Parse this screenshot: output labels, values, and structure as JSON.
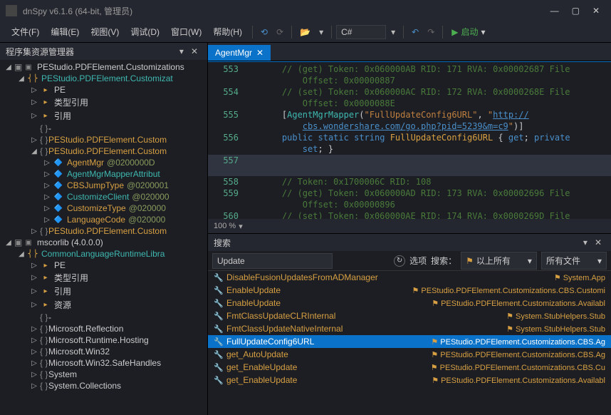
{
  "window": {
    "title": "dnSpy v6.1.6 (64-bit, 管理员)"
  },
  "menubar": {
    "items": [
      "文件(F)",
      "编辑(E)",
      "视图(V)",
      "调试(D)",
      "窗口(W)",
      "帮助(H)"
    ],
    "lang_value": "C#",
    "start_label": "启动"
  },
  "sidebar": {
    "title": "程序集资源管理器",
    "tree": [
      {
        "d": 0,
        "bul": "▣",
        "exp": "◢",
        "ticon": "asm",
        "label": "PEStudio.PDFElement.Customizations",
        "cls": "grey"
      },
      {
        "d": 1,
        "bul": "",
        "exp": "◢",
        "ticon": "ns",
        "label": "PEStudio.PDFElement.Customizat",
        "cls": "teal"
      },
      {
        "d": 2,
        "bul": "",
        "exp": "▷",
        "ticon": "folder",
        "label": "PE",
        "cls": "grey"
      },
      {
        "d": 2,
        "bul": "",
        "exp": "▷",
        "ticon": "folder",
        "label": "类型引用",
        "cls": "grey"
      },
      {
        "d": 2,
        "bul": "",
        "exp": "▷",
        "ticon": "folder",
        "label": "引用",
        "cls": "grey"
      },
      {
        "d": 2,
        "bul": "{ }",
        "exp": "",
        "ticon": "",
        "label": "-",
        "cls": "grey"
      },
      {
        "d": 2,
        "bul": "{ }",
        "exp": "▷",
        "ticon": "",
        "label": "PEStudio.PDFElement.Custom",
        "cls": "orange"
      },
      {
        "d": 2,
        "bul": "{ }",
        "exp": "◢",
        "ticon": "",
        "label": "PEStudio.PDFElement.Custom",
        "cls": "orange"
      },
      {
        "d": 3,
        "bul": "",
        "exp": "▷",
        "ticon": "cls",
        "label": "AgentMgr",
        "cls": "orange",
        "addr": "@0200000D"
      },
      {
        "d": 3,
        "bul": "",
        "exp": "▷",
        "ticon": "cls",
        "label": "AgentMgrMapperAttribut",
        "cls": "teal"
      },
      {
        "d": 3,
        "bul": "",
        "exp": "▷",
        "ticon": "cls",
        "label": "CBSJumpType",
        "cls": "orange",
        "addr": "@0200001"
      },
      {
        "d": 3,
        "bul": "",
        "exp": "▷",
        "ticon": "cls",
        "label": "CustomizeClient",
        "cls": "teal",
        "addr": "@020000"
      },
      {
        "d": 3,
        "bul": "",
        "exp": "▷",
        "ticon": "cls",
        "label": "CustomizeType",
        "cls": "orange",
        "addr": "@020000"
      },
      {
        "d": 3,
        "bul": "",
        "exp": "▷",
        "ticon": "cls",
        "label": "LanguageCode",
        "cls": "orange",
        "addr": "@020000"
      },
      {
        "d": 2,
        "bul": "{ }",
        "exp": "▷",
        "ticon": "",
        "label": "PEStudio.PDFElement.Custom",
        "cls": "orange"
      },
      {
        "d": 0,
        "bul": "▣",
        "exp": "◢",
        "ticon": "asm",
        "label": "mscorlib (4.0.0.0)",
        "cls": "grey"
      },
      {
        "d": 1,
        "bul": "",
        "exp": "◢",
        "ticon": "ns",
        "label": "CommonLanguageRuntimeLibra",
        "cls": "teal"
      },
      {
        "d": 2,
        "bul": "",
        "exp": "▷",
        "ticon": "folder",
        "label": "PE",
        "cls": "grey"
      },
      {
        "d": 2,
        "bul": "",
        "exp": "▷",
        "ticon": "folder",
        "label": "类型引用",
        "cls": "grey"
      },
      {
        "d": 2,
        "bul": "",
        "exp": "▷",
        "ticon": "folder",
        "label": "引用",
        "cls": "grey"
      },
      {
        "d": 2,
        "bul": "",
        "exp": "▷",
        "ticon": "folder",
        "label": "资源",
        "cls": "grey"
      },
      {
        "d": 2,
        "bul": "{ }",
        "exp": "",
        "ticon": "",
        "label": "-",
        "cls": "grey"
      },
      {
        "d": 2,
        "bul": "{ }",
        "exp": "▷",
        "ticon": "",
        "label": "Microsoft.Reflection",
        "cls": "grey"
      },
      {
        "d": 2,
        "bul": "{ }",
        "exp": "▷",
        "ticon": "",
        "label": "Microsoft.Runtime.Hosting",
        "cls": "grey"
      },
      {
        "d": 2,
        "bul": "{ }",
        "exp": "▷",
        "ticon": "",
        "label": "Microsoft.Win32",
        "cls": "grey"
      },
      {
        "d": 2,
        "bul": "{ }",
        "exp": "▷",
        "ticon": "",
        "label": "Microsoft.Win32.SafeHandles",
        "cls": "grey"
      },
      {
        "d": 2,
        "bul": "{ }",
        "exp": "▷",
        "ticon": "",
        "label": "System",
        "cls": "grey"
      },
      {
        "d": 2,
        "bul": "{ }",
        "exp": "▷",
        "ticon": "",
        "label": "System.Collections",
        "cls": "grey"
      }
    ]
  },
  "tabs": [
    {
      "label": "AgentMgr",
      "active": true
    }
  ],
  "editor": {
    "zoom": "100 %",
    "lines": [
      {
        "n": "553",
        "html": "<span class='cm'>// (get) Token: 0x060000AB RID: 171 RVA: 0x00002687 File</span>"
      },
      {
        "n": "",
        "html": "<span class='cm'>Offset: 0x00000887</span>"
      },
      {
        "n": "554",
        "html": "<span class='cm'>// (set) Token: 0x060000AC RID: 172 RVA: 0x0000268E File</span>"
      },
      {
        "n": "",
        "html": "<span class='cm'>Offset: 0x0000088E</span>"
      },
      {
        "n": "555",
        "html": "[<span class='ty'>AgentMgrMapper</span>(<span class='str'>\"FullUpdateConfig6URL\"</span>, <span class='str'>\"</span><span class='lnk'>http://</span>"
      },
      {
        "n": "",
        "html": "<span class='lnk'>cbs.wondershare.com/go.php?pid=5239&amp;m=c9</span><span class='str'>\"</span>)]"
      },
      {
        "n": "556",
        "html": "<span class='kw'>public</span> <span class='kw'>static</span> <span class='kw'>string</span> <span class='mth'>FullUpdateConfig6URL</span> { <span class='kw'>get</span>; <span class='kw'>private</span>"
      },
      {
        "n": "",
        "html": "<span class='kw'>set</span>; }"
      },
      {
        "n": "557",
        "html": "",
        "hl": true
      },
      {
        "n": "558",
        "html": "<span class='cm'>// Token: 0x1700006C RID: 108</span>"
      },
      {
        "n": "559",
        "html": "<span class='cm'>// (get) Token: 0x060000AD RID: 173 RVA: 0x00002696 File</span>"
      },
      {
        "n": "",
        "html": "<span class='cm'>Offset: 0x00000896</span>"
      },
      {
        "n": "560",
        "html": "<span class='cm'>// (set) Token: 0x060000AE RID: 174 RVA: 0x0000269D File</span>"
      }
    ]
  },
  "search": {
    "title": "搜索",
    "query": "Update",
    "opt_label": "选项",
    "filter_label": "搜索：",
    "filter1": "以上所有",
    "filter2": "所有文件",
    "results": [
      {
        "icon": "wrench",
        "name": "DisableFusionUpdatesFromADManager",
        "loc": "System.App",
        "sel": false
      },
      {
        "icon": "wrench",
        "name": "EnableUpdate",
        "loc": "PEStudio.PDFElement.Customizations.CBS.Customi",
        "sel": false
      },
      {
        "icon": "wrench",
        "name": "EnableUpdate",
        "loc": "PEStudio.PDFElement.Customizations.Availabl",
        "sel": false
      },
      {
        "icon": "wrench",
        "name": "FmtClassUpdateCLRInternal",
        "loc": "System.StubHelpers.Stub",
        "sel": false
      },
      {
        "icon": "wrench",
        "name": "FmtClassUpdateNativeInternal",
        "loc": "System.StubHelpers.Stub",
        "sel": false
      },
      {
        "icon": "wrench",
        "name": "FullUpdateConfig6URL",
        "loc": "PEStudio.PDFElement.Customizations.CBS.Ag",
        "sel": true
      },
      {
        "icon": "wrench",
        "name": "get_AutoUpdate",
        "loc": "PEStudio.PDFElement.Customizations.CBS.Ag",
        "sel": false
      },
      {
        "icon": "wrench",
        "name": "get_EnableUpdate",
        "loc": "PEStudio.PDFElement.Customizations.CBS.Cu",
        "sel": false
      },
      {
        "icon": "wrench",
        "name": "get_EnableUpdate",
        "loc": "PEStudio.PDFElement.Customizations.Availabl",
        "sel": false
      }
    ]
  }
}
